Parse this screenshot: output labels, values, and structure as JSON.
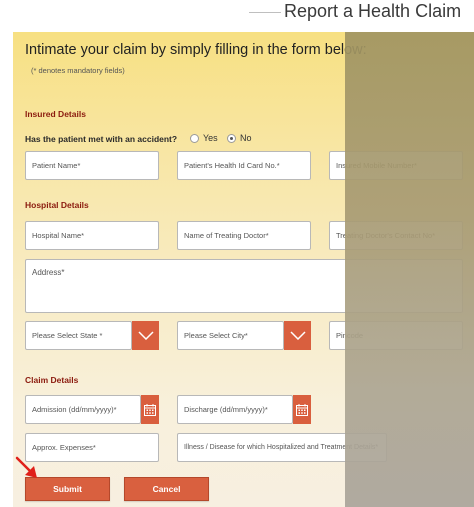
{
  "header": {
    "title": "Report a Health Claim"
  },
  "form": {
    "intro": "Intimate your claim by simply filling in the form below:",
    "mandatory_note": "(* denotes mandatory fields)",
    "sections": {
      "insured": "Insured Details",
      "hospital": "Hospital Details",
      "claim": "Claim Details"
    },
    "accident_question": "Has the patient met with an accident?",
    "accident_options": {
      "yes": "Yes",
      "no": "No",
      "selected": "No"
    },
    "placeholders": {
      "patient_name": "Patient Name*",
      "health_id": "Patient's Health Id Card No.*",
      "insured_mobile": "Insured Mobile Number*",
      "hospital_name": "Hospital Name*",
      "doctor_name": "Name of Treating Doctor*",
      "doctor_contact": "Treating Doctor's Contact No*",
      "address": "Address*",
      "state": "Please Select State *",
      "city": "Please Select City*",
      "pincode": "Pincode",
      "admission": "Admission (dd/mm/yyyy)*",
      "discharge": "Discharge (dd/mm/yyyy)*",
      "expenses": "Approx. Expenses*",
      "illness": "Illness / Disease for which Hospitalized and Treatment Details*"
    },
    "buttons": {
      "submit": "Submit",
      "cancel": "Cancel"
    }
  },
  "colors": {
    "accent": "#d95f3e",
    "section_heading": "#8b1a0e",
    "pointer": "#e0201a"
  },
  "icons": {
    "select_arrow": "chevron-down-icon",
    "calendar": "calendar-icon",
    "pointer": "red-arrow-icon"
  }
}
